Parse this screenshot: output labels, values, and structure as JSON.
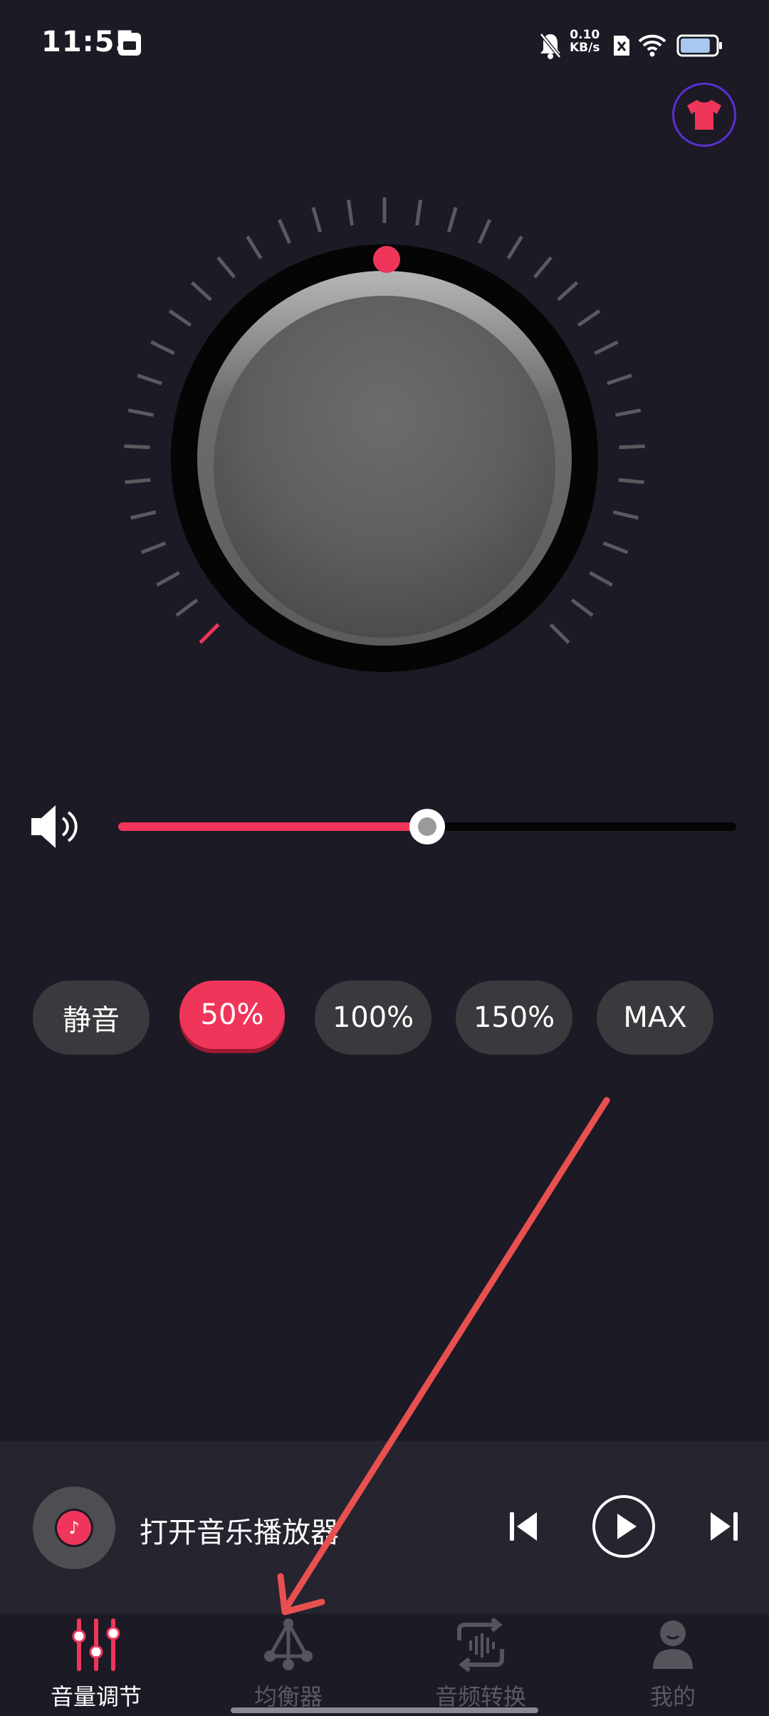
{
  "status_bar": {
    "time": "11:55",
    "net_speed_value": "0.10",
    "net_speed_unit": "KB/s",
    "battery_level": 0.85
  },
  "theme_button": {
    "icon": "tshirt-icon",
    "color": "#f0355a"
  },
  "knob": {
    "indicator_color": "#f0355a",
    "level_fraction": 0.5
  },
  "volume_slider": {
    "value_fraction": 0.5,
    "fill_color": "#f0355a"
  },
  "presets": [
    {
      "label": "静音",
      "active": false
    },
    {
      "label": "50%",
      "active": true
    },
    {
      "label": "100%",
      "active": false
    },
    {
      "label": "150%",
      "active": false
    },
    {
      "label": "MAX",
      "active": false
    }
  ],
  "player": {
    "title": "打开音乐播放器"
  },
  "nav": {
    "items": [
      {
        "label": "音量调节",
        "icon": "sliders-icon",
        "active": true
      },
      {
        "label": "均衡器",
        "icon": "equalizer-network-icon",
        "active": false
      },
      {
        "label": "音频转换",
        "icon": "audio-convert-icon",
        "active": false
      },
      {
        "label": "我的",
        "icon": "user-icon",
        "active": false
      }
    ]
  },
  "colors": {
    "background": "#1b1a25",
    "accent": "#f0355a",
    "chip": "#3a3a3e",
    "annotation_arrow": "#e8504f"
  }
}
